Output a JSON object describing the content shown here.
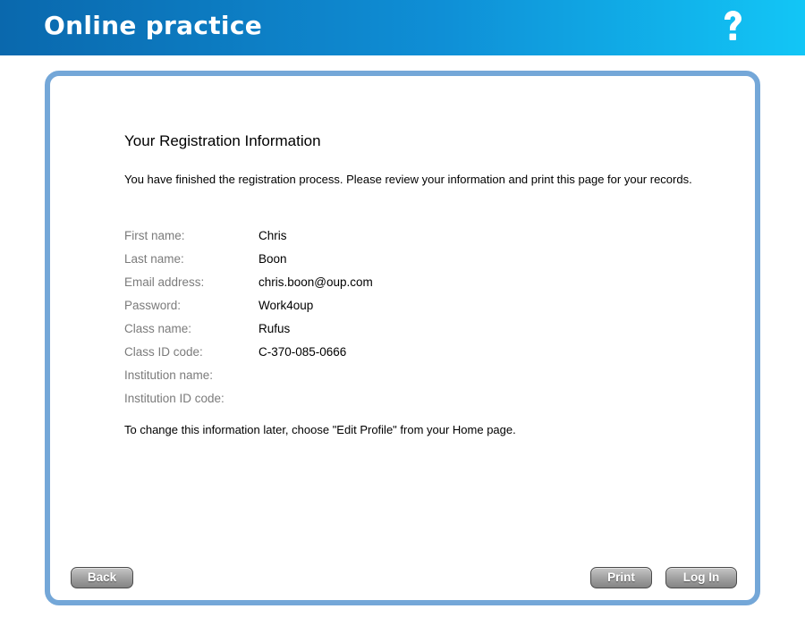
{
  "header": {
    "title": "Online practice",
    "help_icon": "question-mark-icon"
  },
  "colors": {
    "header_start": "#0a68ad",
    "header_end": "#12c6f6",
    "panel_border": "#74a7d8",
    "label_text": "#7b7b7b"
  },
  "main": {
    "title": "Your Registration Information",
    "intro": "You have finished the registration process. Please review your information and print this page for your records.",
    "fields": [
      {
        "label": "First name:",
        "value": "Chris"
      },
      {
        "label": "Last name:",
        "value": "Boon"
      },
      {
        "label": "Email address:",
        "value": "chris.boon@oup.com"
      },
      {
        "label": "Password:",
        "value": "Work4oup"
      },
      {
        "label": "Class name:",
        "value": "Rufus"
      },
      {
        "label": "Class ID code:",
        "value": "C-370-085-0666"
      },
      {
        "label": "Institution name:",
        "value": ""
      },
      {
        "label": "Institution ID code:",
        "value": ""
      }
    ],
    "note": "To change this information later, choose \"Edit Profile\" from your Home page."
  },
  "buttons": {
    "back": "Back",
    "print": "Print",
    "login": "Log In"
  }
}
